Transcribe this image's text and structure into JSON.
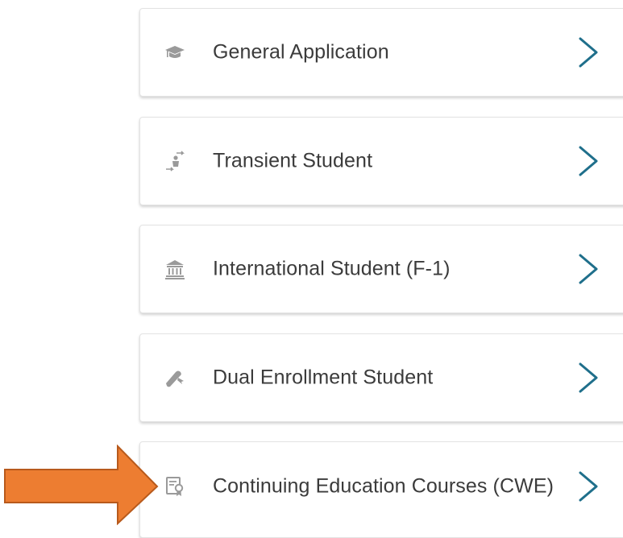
{
  "options": [
    {
      "id": "general",
      "label": "General Application",
      "icon": "graduation-cap-icon"
    },
    {
      "id": "transient",
      "label": "Transient Student",
      "icon": "transfer-student-icon"
    },
    {
      "id": "international",
      "label": "International Student (F-1)",
      "icon": "institution-icon"
    },
    {
      "id": "dual",
      "label": "Dual Enrollment Student",
      "icon": "diploma-icon"
    },
    {
      "id": "cwe",
      "label": "Continuing Education Courses (CWE)",
      "icon": "certificate-icon"
    }
  ],
  "colors": {
    "chevron": "#1f6f8b",
    "icon": "#9a9a9a",
    "text": "#3b3b3b",
    "highlight_arrow": "#ed7d31",
    "highlight_arrow_border": "#b85a1c"
  }
}
